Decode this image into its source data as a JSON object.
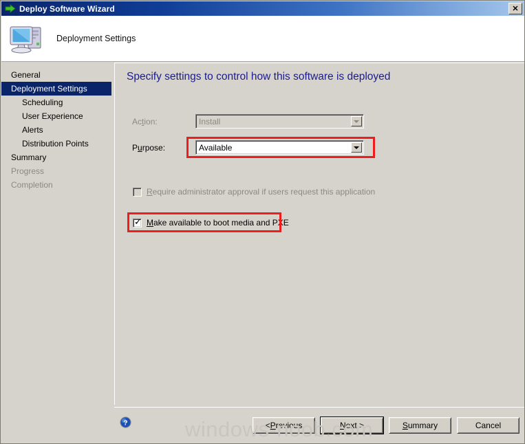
{
  "window": {
    "title": "Deploy Software Wizard",
    "close_label": "✕",
    "title_icon": "green-arrow-icon"
  },
  "header": {
    "title": "Deployment Settings",
    "icon": "computer-icon"
  },
  "sidebar": {
    "items": [
      {
        "label": "General",
        "level": 0,
        "state": "enabled"
      },
      {
        "label": "Deployment Settings",
        "level": 0,
        "state": "selected"
      },
      {
        "label": "Scheduling",
        "level": 1,
        "state": "enabled"
      },
      {
        "label": "User Experience",
        "level": 1,
        "state": "enabled"
      },
      {
        "label": "Alerts",
        "level": 1,
        "state": "enabled"
      },
      {
        "label": "Distribution Points",
        "level": 1,
        "state": "enabled"
      },
      {
        "label": "Summary",
        "level": 0,
        "state": "enabled"
      },
      {
        "label": "Progress",
        "level": 0,
        "state": "disabled"
      },
      {
        "label": "Completion",
        "level": 0,
        "state": "disabled"
      }
    ]
  },
  "main": {
    "heading": "Specify settings to control how this software is deployed",
    "fields": {
      "action": {
        "label_pre": "Ac",
        "label_acc": "t",
        "label_post": "ion:",
        "value": "Install",
        "state": "disabled"
      },
      "purpose": {
        "label_pre": "P",
        "label_acc": "u",
        "label_post": "rpose:",
        "value": "Available",
        "state": "enabled",
        "highlighted": true
      }
    },
    "checkboxes": [
      {
        "label_pre": "",
        "label_acc": "R",
        "label_post": "equire administrator approval if users request this application",
        "checked": false,
        "state": "disabled",
        "highlighted": false
      },
      {
        "label_pre": "",
        "label_acc": "M",
        "label_post": "ake available to boot media and PXE",
        "checked": true,
        "state": "enabled",
        "highlighted": true
      }
    ]
  },
  "footer": {
    "help_icon": "help-question-icon",
    "buttons": [
      {
        "pre": "< ",
        "acc": "P",
        "post": "revious",
        "default": false
      },
      {
        "pre": "",
        "acc": "N",
        "post": "ext >",
        "default": true
      },
      {
        "pre": "",
        "acc": "S",
        "post": "ummary",
        "default": false
      },
      {
        "pre": "",
        "acc": "",
        "post": "Cancel",
        "default": false
      }
    ]
  },
  "watermark": {
    "text": "windows-noob.com"
  },
  "colors": {
    "titlebar_start": "#0a246a",
    "titlebar_end": "#a6c8ec",
    "face": "#d6d3cc",
    "heading": "#1b1b8f",
    "selection": "#0a246a",
    "annotation_red": "#ee1c1c",
    "disabled_text": "#8a8a80"
  }
}
